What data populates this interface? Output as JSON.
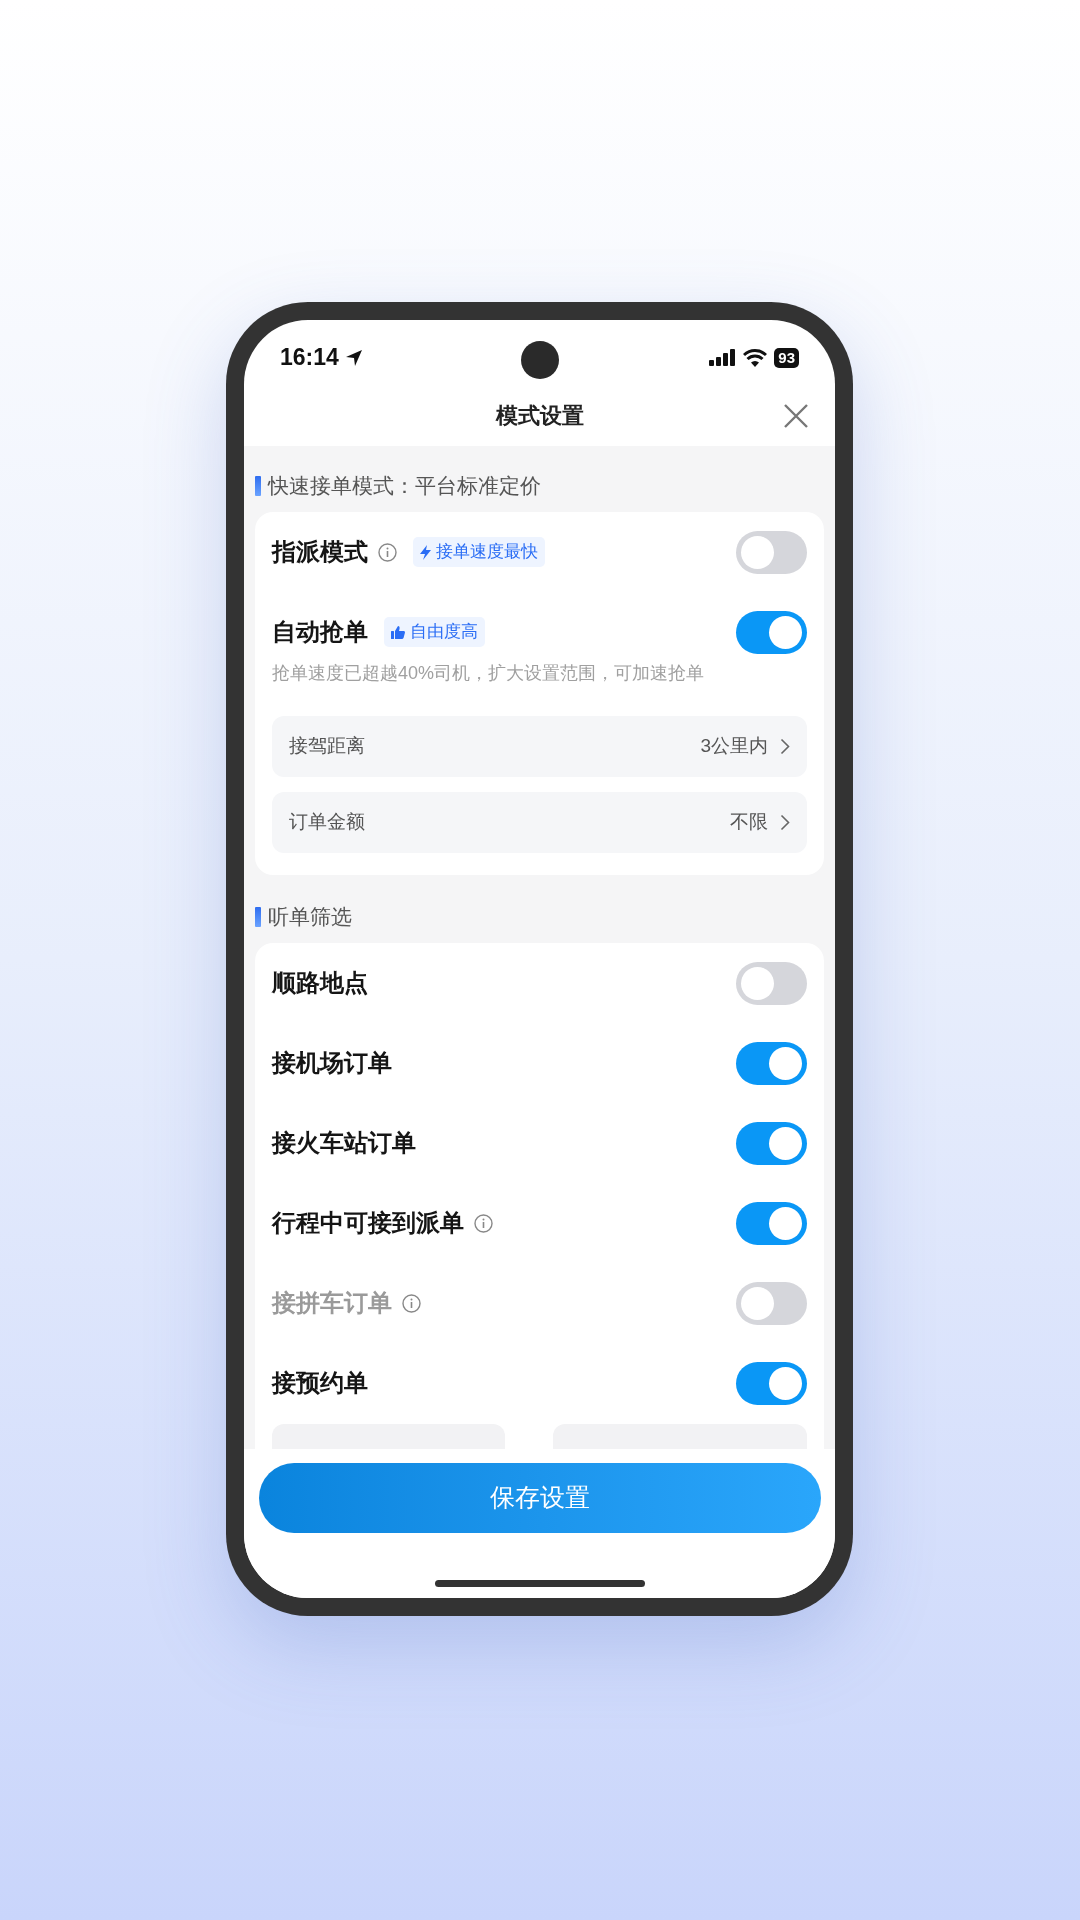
{
  "status_bar": {
    "time": "16:14",
    "battery": "93"
  },
  "title": "模式设置",
  "sections": [
    {
      "header": "快速接单模式：平台标准定价",
      "items": [
        {
          "kind": "toggle",
          "label": "指派模式",
          "info": true,
          "disabled": false,
          "badge": "接单速度最快",
          "on": false
        },
        {
          "kind": "toggle",
          "label": "自动抢单",
          "info": false,
          "disabled": false,
          "badge": "自由度高",
          "on": true,
          "description": "抢单速度已超越40%司机，扩大设置范围，可加速抢单"
        },
        {
          "kind": "picker",
          "label": "接驾距离",
          "value": "3公里内"
        },
        {
          "kind": "picker",
          "label": "订单金额",
          "value": "不限"
        }
      ]
    },
    {
      "header": "听单筛选",
      "items": [
        {
          "kind": "toggle",
          "label": "顺路地点",
          "info": false,
          "disabled": false,
          "on": false
        },
        {
          "kind": "toggle",
          "label": "接机场订单",
          "info": false,
          "disabled": false,
          "on": true
        },
        {
          "kind": "toggle",
          "label": "接火车站订单",
          "info": false,
          "disabled": false,
          "on": true
        },
        {
          "kind": "toggle",
          "label": "行程中可接到派单",
          "info": true,
          "disabled": false,
          "on": true
        },
        {
          "kind": "toggle",
          "label": "接拼车订单",
          "info": true,
          "disabled": true,
          "on": false
        },
        {
          "kind": "toggle",
          "label": "接预约单",
          "info": false,
          "disabled": false,
          "on": true
        },
        {
          "kind": "range"
        }
      ]
    }
  ],
  "save_button": "保存设置"
}
